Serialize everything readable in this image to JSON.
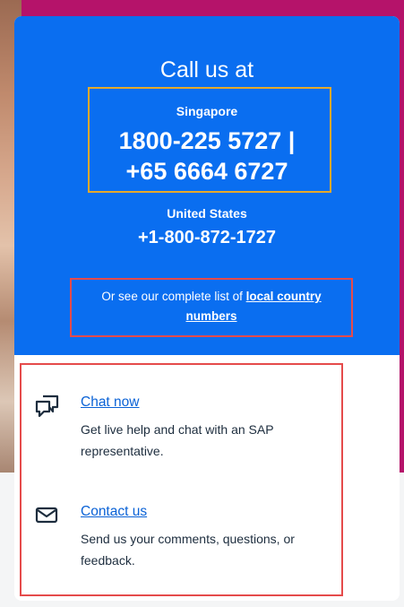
{
  "call": {
    "title": "Call us at",
    "singapore": {
      "label": "Singapore",
      "phone_line1": "1800-225 5727 |",
      "phone_line2": "+65 6664 6727"
    },
    "us": {
      "label": "United States",
      "phone": "+1-800-872-1727"
    },
    "local": {
      "prefix": "Or see our complete list of ",
      "link_line1": "local country",
      "link_line2": "numbers"
    }
  },
  "options": [
    {
      "icon": "chat-icon",
      "link": "Chat now",
      "description": "Get live help and chat with an SAP representative."
    },
    {
      "icon": "mail-icon",
      "link": "Contact us",
      "description": "Send us your comments, questions, or feedback."
    }
  ],
  "colors": {
    "hero": "#0a6ef0",
    "magenta": "#b5136a",
    "highlight_yellow": "#e5a92b",
    "highlight_red": "#e54b4b",
    "link": "#0a62d6"
  }
}
